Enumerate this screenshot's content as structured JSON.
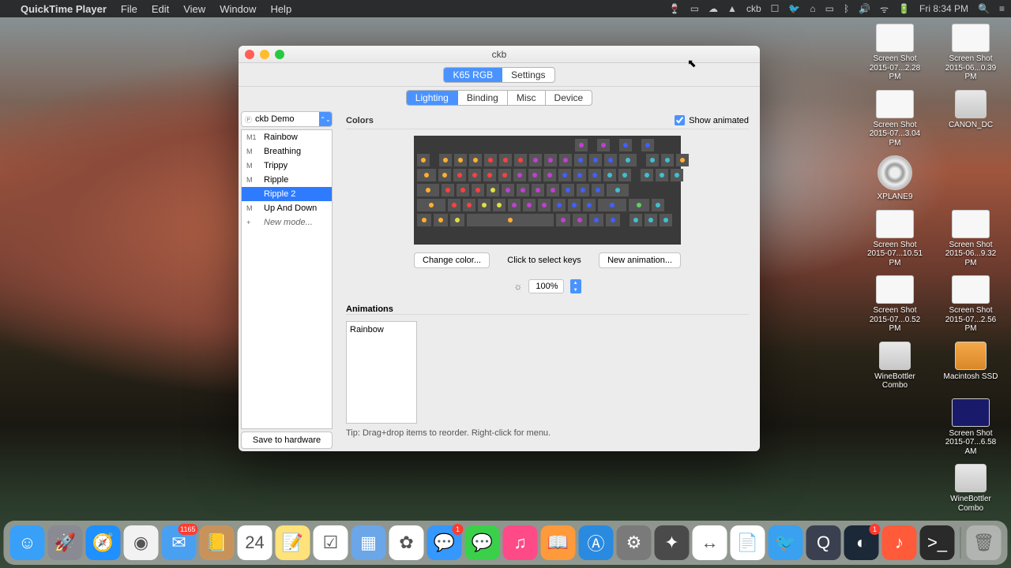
{
  "menubar": {
    "app": "QuickTime Player",
    "menus": [
      "File",
      "Edit",
      "View",
      "Window",
      "Help"
    ],
    "clock": "Fri 8:34 PM"
  },
  "window": {
    "title": "ckb",
    "topTabs": [
      "K65 RGB",
      "Settings"
    ],
    "topTabActive": 0,
    "subTabs": [
      "Lighting",
      "Binding",
      "Misc",
      "Device"
    ],
    "subTabActive": 0,
    "profile": "ckb Demo",
    "modes": [
      {
        "pre": "M1",
        "label": "Rainbow"
      },
      {
        "pre": "M",
        "label": "Breathing"
      },
      {
        "pre": "M",
        "label": "Trippy"
      },
      {
        "pre": "M",
        "label": "Ripple"
      },
      {
        "pre": "",
        "label": "Ripple 2",
        "selected": true
      },
      {
        "pre": "M",
        "label": "Up And Down"
      },
      {
        "pre": "+",
        "label": "New mode...",
        "new": true
      }
    ],
    "saveHardware": "Save to hardware",
    "colorsLabel": "Colors",
    "showAnimated": "Show animated",
    "changeColor": "Change color...",
    "clickToSelect": "Click to select keys",
    "newAnimation": "New animation...",
    "brightness": "100%",
    "animationsLabel": "Animations",
    "animationsList": [
      "Rainbow"
    ],
    "tip": "Tip: Drag+drop items to reorder. Right-click for menu."
  },
  "desktopIcons": [
    [
      {
        "t": "img",
        "l": "Screen Shot 2015-07...2.28 PM"
      },
      {
        "t": "img",
        "l": "Screen Shot 2015-06...0.39 PM"
      }
    ],
    [
      {
        "t": "img",
        "l": "Screen Shot 2015-07...3.04 PM"
      },
      {
        "t": "drive",
        "l": "CANON_DC"
      }
    ],
    [
      {
        "t": "disc",
        "l": "XPLANE9"
      },
      null
    ],
    [
      {
        "t": "img",
        "l": "Screen Shot 2015-07...10.51 PM"
      },
      {
        "t": "img",
        "l": "Screen Shot 2015-06...9.32 PM"
      }
    ],
    [
      {
        "t": "img",
        "l": "Screen Shot 2015-07...0.52 PM"
      },
      {
        "t": "img",
        "l": "Screen Shot 2015-07...2.56 PM"
      }
    ],
    [
      {
        "t": "drive",
        "l": "WineBottler Combo"
      },
      {
        "t": "ssd",
        "l": "Macintosh SSD"
      }
    ],
    [
      null,
      {
        "t": "dark",
        "l": "Screen Shot 2015-07...6.58 AM"
      }
    ],
    [
      null,
      {
        "t": "drive",
        "l": "WineBottler Combo"
      }
    ]
  ],
  "kbdColors": {
    "palette": [
      "#60d060",
      "#ffb030",
      "#ff4040",
      "#c040d0",
      "#4060ff",
      "#40c0d0",
      "#e0e040"
    ],
    "rows": [
      {
        "offset": 200,
        "keys": [
          [
            16,
            3
          ],
          [
            6,
            0
          ],
          [
            16,
            3
          ],
          [
            6,
            0
          ],
          [
            16,
            4
          ],
          [
            6,
            0
          ],
          [
            16,
            4
          ]
        ]
      },
      {
        "offset": 0,
        "keys": [
          [
            16,
            1
          ],
          [
            6,
            0
          ],
          [
            16,
            1
          ],
          [
            16,
            1
          ],
          [
            16,
            1
          ],
          [
            16,
            2
          ],
          [
            16,
            2
          ],
          [
            16,
            2
          ],
          [
            16,
            3
          ],
          [
            16,
            3
          ],
          [
            16,
            3
          ],
          [
            16,
            4
          ],
          [
            16,
            4
          ],
          [
            16,
            4
          ],
          [
            22,
            5
          ],
          [
            6,
            0
          ],
          [
            16,
            5
          ],
          [
            16,
            5
          ],
          [
            16,
            1
          ]
        ]
      },
      {
        "offset": 0,
        "keys": [
          [
            24,
            1
          ],
          [
            16,
            1
          ],
          [
            16,
            2
          ],
          [
            16,
            2
          ],
          [
            16,
            2
          ],
          [
            16,
            2
          ],
          [
            16,
            3
          ],
          [
            16,
            3
          ],
          [
            16,
            3
          ],
          [
            16,
            4
          ],
          [
            16,
            4
          ],
          [
            16,
            4
          ],
          [
            16,
            5
          ],
          [
            16,
            5
          ],
          [
            6,
            0
          ],
          [
            16,
            5
          ],
          [
            16,
            5
          ],
          [
            16,
            5
          ]
        ]
      },
      {
        "offset": 0,
        "keys": [
          [
            28,
            1
          ],
          [
            16,
            2
          ],
          [
            16,
            2
          ],
          [
            16,
            2
          ],
          [
            16,
            6
          ],
          [
            16,
            3
          ],
          [
            16,
            3
          ],
          [
            16,
            3
          ],
          [
            16,
            3
          ],
          [
            16,
            4
          ],
          [
            16,
            4
          ],
          [
            16,
            4
          ],
          [
            28,
            5
          ]
        ]
      },
      {
        "offset": 0,
        "keys": [
          [
            36,
            1
          ],
          [
            16,
            2
          ],
          [
            16,
            2
          ],
          [
            16,
            6
          ],
          [
            16,
            6
          ],
          [
            16,
            3
          ],
          [
            16,
            3
          ],
          [
            16,
            3
          ],
          [
            16,
            4
          ],
          [
            16,
            4
          ],
          [
            16,
            4
          ],
          [
            36,
            4
          ],
          [
            26,
            0
          ],
          [
            16,
            5
          ]
        ]
      },
      {
        "offset": 0,
        "keys": [
          [
            18,
            1
          ],
          [
            18,
            1
          ],
          [
            18,
            6
          ],
          [
            110,
            1
          ],
          [
            18,
            3
          ],
          [
            18,
            3
          ],
          [
            18,
            4
          ],
          [
            18,
            4
          ],
          [
            6,
            0
          ],
          [
            16,
            5
          ],
          [
            16,
            5
          ],
          [
            16,
            5
          ]
        ]
      }
    ]
  },
  "dock": {
    "items": [
      {
        "n": "finder",
        "c": "#38a0f8",
        "g": "☺"
      },
      {
        "n": "launchpad",
        "c": "#8a8a92",
        "g": "🚀"
      },
      {
        "n": "safari",
        "c": "#1e90ff",
        "g": "🧭"
      },
      {
        "n": "chrome",
        "c": "#f2f2f2",
        "g": "◉"
      },
      {
        "n": "mail",
        "c": "#4aa0f0",
        "g": "✉",
        "b": "1165"
      },
      {
        "n": "contacts",
        "c": "#c8935a",
        "g": "📒"
      },
      {
        "n": "calendar",
        "c": "#ffffff",
        "g": "24"
      },
      {
        "n": "notes",
        "c": "#ffe27a",
        "g": "📝"
      },
      {
        "n": "reminders",
        "c": "#ffffff",
        "g": "☑"
      },
      {
        "n": "office",
        "c": "#6aa6e8",
        "g": "▦"
      },
      {
        "n": "photos",
        "c": "#ffffff",
        "g": "✿"
      },
      {
        "n": "messages1",
        "c": "#3498ff",
        "g": "💬",
        "b": "1"
      },
      {
        "n": "messages2",
        "c": "#3ad04a",
        "g": "💬"
      },
      {
        "n": "itunes",
        "c": "#ff4a88",
        "g": "♫"
      },
      {
        "n": "ibooks",
        "c": "#ff9a3a",
        "g": "📖"
      },
      {
        "n": "appstore",
        "c": "#2a8adf",
        "g": "Ⓐ"
      },
      {
        "n": "sysprefs",
        "c": "#7a7a7a",
        "g": "⚙"
      },
      {
        "n": "fcp",
        "c": "#4a4a4a",
        "g": "✦"
      },
      {
        "n": "teamviewer",
        "c": "#ffffff",
        "g": "↔"
      },
      {
        "n": "pages",
        "c": "#ffffff",
        "g": "📄"
      },
      {
        "n": "twitter",
        "c": "#3aa0f0",
        "g": "🐦"
      },
      {
        "n": "qt",
        "c": "#3a4050",
        "g": "Q"
      },
      {
        "n": "steam",
        "c": "#1a2838",
        "g": "◐",
        "b": "1"
      },
      {
        "n": "music",
        "c": "#ff5a3a",
        "g": "♪"
      },
      {
        "n": "terminal",
        "c": "#2a2a2a",
        "g": ">_"
      }
    ],
    "trash": {
      "g": "🗑"
    }
  }
}
